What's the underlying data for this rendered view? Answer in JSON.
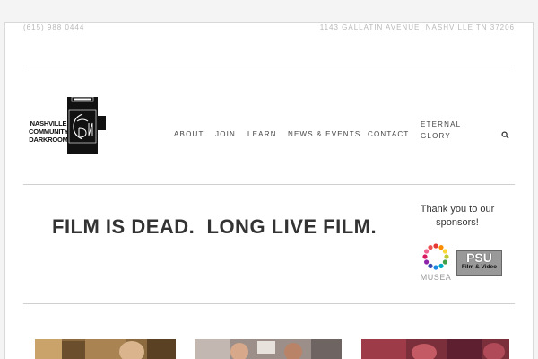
{
  "topbar": {
    "phone": "(615) 988 0444",
    "address": "1143 GALLATIN AVENUE, NASHVILLE TN 37206"
  },
  "logo": {
    "line1": "NASHVILLE",
    "line2": "COMMUNITY",
    "line3": "DARKROOM"
  },
  "nav": {
    "items": [
      "ABOUT",
      "JOIN",
      "LEARN",
      "NEWS & EVENTS",
      "CONTACT"
    ],
    "eternal_line1": "ETERNAL",
    "eternal_line2": "GLORY",
    "search_icon": "search-icon"
  },
  "hero": {
    "headline": "FILM IS DEAD.  LONG LIVE FILM."
  },
  "sponsors": {
    "heading_line1": "Thank you to our",
    "heading_line2": "sponsors!",
    "musea_label": "MUSEA",
    "psu_line1": "PSU",
    "psu_line2": "Film & Video"
  }
}
